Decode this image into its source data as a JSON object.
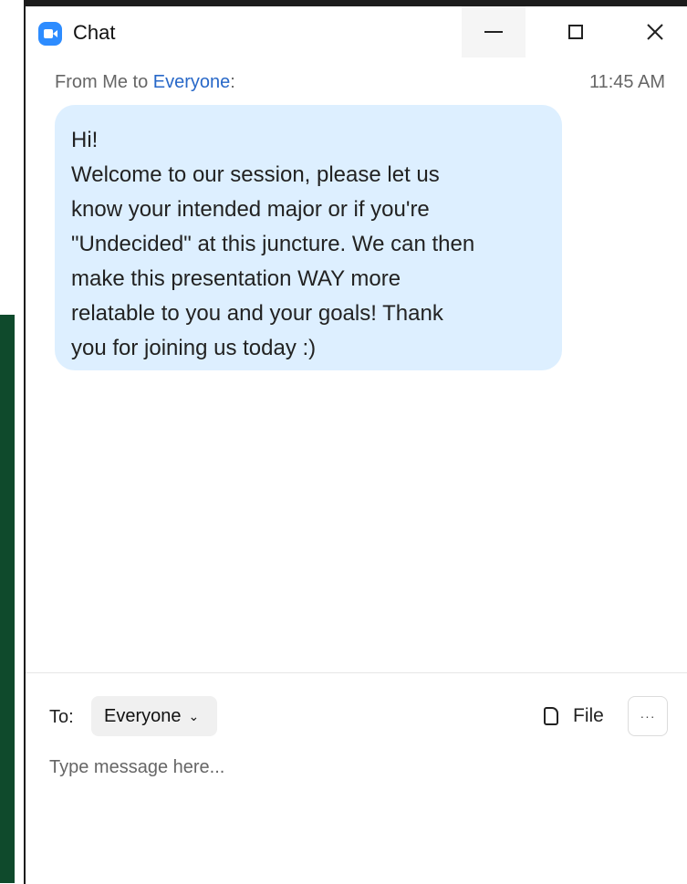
{
  "window": {
    "title": "Chat"
  },
  "message": {
    "sender_prefix": "From Me to ",
    "recipient": "Everyone",
    "suffix": ":",
    "time": "11:45 AM",
    "lines": [
      "Hi!",
      "Welcome to our session, please let us",
      "know your intended major or if you're",
      "\"Undecided\" at this juncture. We can then",
      "make this presentation WAY more",
      "relatable to you and your goals! Thank",
      "you for joining us today :)"
    ]
  },
  "composer": {
    "to_label": "To:",
    "recipient_value": "Everyone",
    "file_label": "File",
    "more_label": "···",
    "placeholder": "Type message here..."
  },
  "icons": {
    "app": "zoom-camera-icon",
    "minimize": "minimize-icon",
    "maximize": "maximize-icon",
    "close": "close-icon",
    "file": "file-icon",
    "more": "more-icon",
    "dropdown": "chevron-down-icon"
  }
}
